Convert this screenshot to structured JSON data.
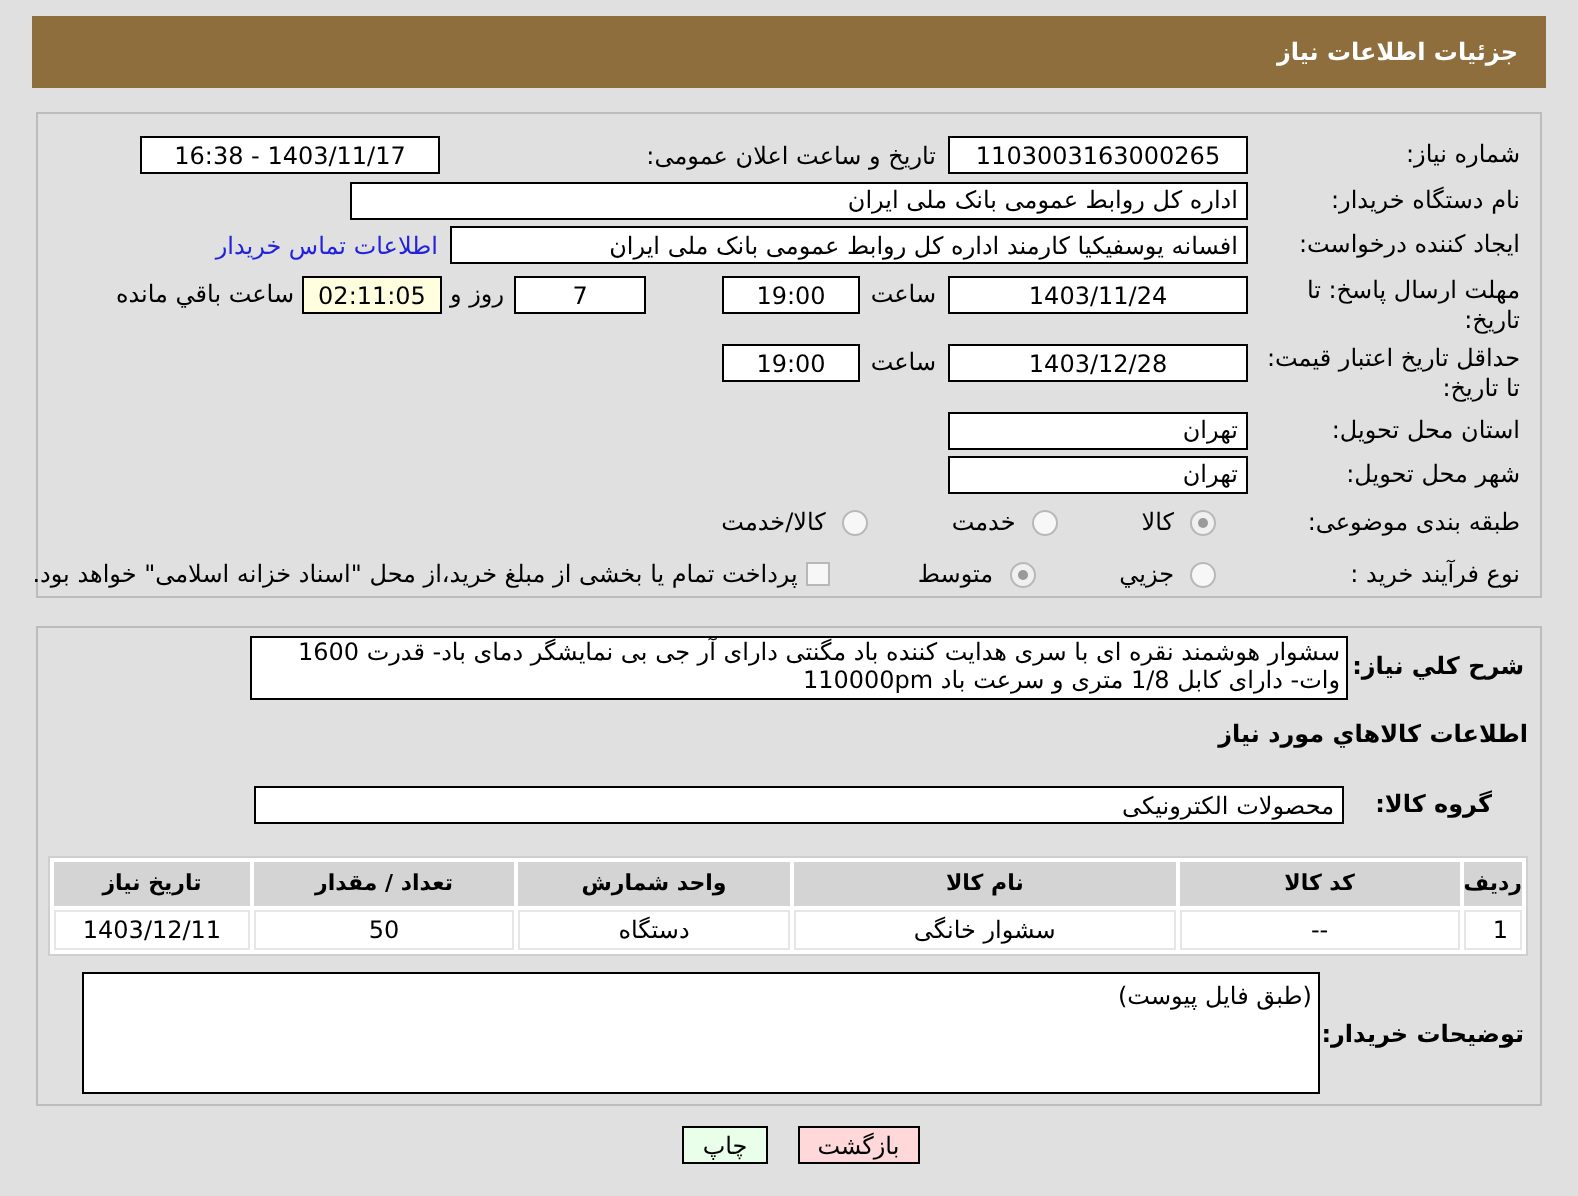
{
  "header": {
    "title": "جزئیات اطلاعات نیاز"
  },
  "need_number": {
    "label": "شماره نیاز:",
    "value": "1103003163000265"
  },
  "announce": {
    "label": "تاریخ و ساعت اعلان عمومی:",
    "value": "1403/11/17 - 16:38"
  },
  "buyer_org": {
    "label": "نام دستگاه خریدار:",
    "value": "اداره کل روابط عمومی بانک ملی ایران"
  },
  "requester": {
    "label": "ایجاد کننده درخواست:",
    "value": "افسانه یوسفیکیا کارمند اداره کل روابط عمومی بانک ملی ایران",
    "link": "اطلاعات تماس خریدار"
  },
  "deadline": {
    "label": "مهلت ارسال پاسخ: تا تاریخ:",
    "date": "1403/11/24",
    "time_label": "ساعت",
    "time": "19:00",
    "days": "7",
    "days_label": "روز و",
    "remaining": "02:11:05",
    "remaining_label": "ساعت باقي مانده"
  },
  "validity": {
    "label": "حداقل تاریخ اعتبار قیمت: تا تاریخ:",
    "date": "1403/12/28",
    "time_label": "ساعت",
    "time": "19:00"
  },
  "province": {
    "label": "استان محل تحویل:",
    "value": "تهران"
  },
  "city": {
    "label": "شهر محل تحویل:",
    "value": "تهران"
  },
  "category": {
    "label": "طبقه بندی موضوعی:",
    "options": [
      {
        "label": "کالا",
        "selected": true
      },
      {
        "label": "خدمت",
        "selected": false
      },
      {
        "label": "کالا/خدمت",
        "selected": false
      }
    ]
  },
  "process": {
    "label": "نوع فرآیند خرید :",
    "options": [
      {
        "label": "جزیي",
        "selected": false
      },
      {
        "label": "متوسط",
        "selected": true
      }
    ],
    "treasury": {
      "label": "پرداخت تمام یا بخشی از مبلغ خرید،از محل \"اسناد خزانه اسلامی\" خواهد بود.",
      "checked": false
    }
  },
  "description": {
    "label": "شرح کلي نياز:",
    "value": "سشوار هوشمند  نقره ای با سری هدایت کننده باد مگنتی دارای آر جی بی نمایشگر دمای باد- قدرت 1600 وات- دارای کابل 1/8 متری و سرعت باد  110000pm"
  },
  "goods_title": "اطلاعات کالاهاي مورد نياز",
  "goods_group": {
    "label": "گروه کالا:",
    "value": "محصولات الکترونیکی"
  },
  "table": {
    "columns": [
      "ردیف",
      "کد کالا",
      "نام کالا",
      "واحد شمارش",
      "تعداد / مقدار",
      "تاریخ نیاز"
    ],
    "rows": [
      [
        "1",
        "--",
        "سشوار خانگی",
        "دستگاه",
        "50",
        "1403/12/11"
      ]
    ]
  },
  "buyer_notes": {
    "label": "توضیحات خریدار:",
    "value": "(طبق فایل پیوست)"
  },
  "buttons": [
    {
      "kind": "back",
      "label": "بازگشت"
    },
    {
      "kind": "print",
      "label": "چاپ"
    }
  ]
}
